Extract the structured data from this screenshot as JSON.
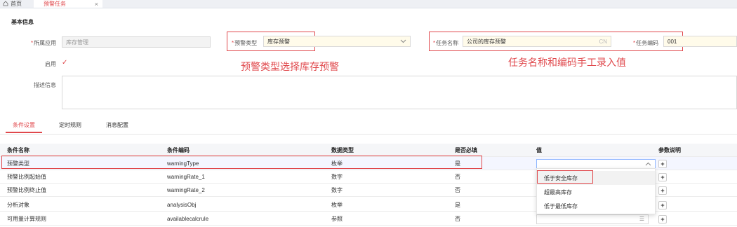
{
  "tabs": {
    "home_label": "首页",
    "active_label": "预警任务",
    "close_glyph": "×"
  },
  "basic": {
    "title": "基本信息",
    "app_label": "所属应用",
    "app_placeholder": "库存管理",
    "type_label": "预警类型",
    "type_value": "库存预警",
    "name_label": "任务名称",
    "name_value": "公司的库存预警",
    "name_lang": "CN",
    "code_label": "任务编码",
    "code_value": "001",
    "enable_label": "启用",
    "enable_check": "✓",
    "desc_label": "描述信息"
  },
  "annotations": {
    "type_note": "预警类型选择库存预警",
    "name_note": "任务名称和编码手工录入值"
  },
  "subtabs": [
    "条件设置",
    "定时规则",
    "消息配置"
  ],
  "table": {
    "headers": [
      "条件名称",
      "条件编码",
      "数据类型",
      "是否必填",
      "值",
      "参数说明"
    ],
    "rows": [
      {
        "name": "预警类型",
        "code": "warningType",
        "dtype": "枚举",
        "required": "是"
      },
      {
        "name": "预警比例起始值",
        "code": "warningRate_1",
        "dtype": "数字",
        "required": "否"
      },
      {
        "name": "预警比例终止值",
        "code": "warningRate_2",
        "dtype": "数字",
        "required": "否"
      },
      {
        "name": "分析对象",
        "code": "analysisObj",
        "dtype": "枚举",
        "required": "是"
      },
      {
        "name": "可用量计算规则",
        "code": "availablecalcrule",
        "dtype": "参照",
        "required": "否"
      }
    ],
    "plus_glyph": "+"
  },
  "dropdown": {
    "options": [
      "低于安全库存",
      "超最高库存",
      "低于最低库存"
    ]
  },
  "colors": {
    "accent": "#e0484c",
    "header_bg": "#f5f6f8"
  }
}
